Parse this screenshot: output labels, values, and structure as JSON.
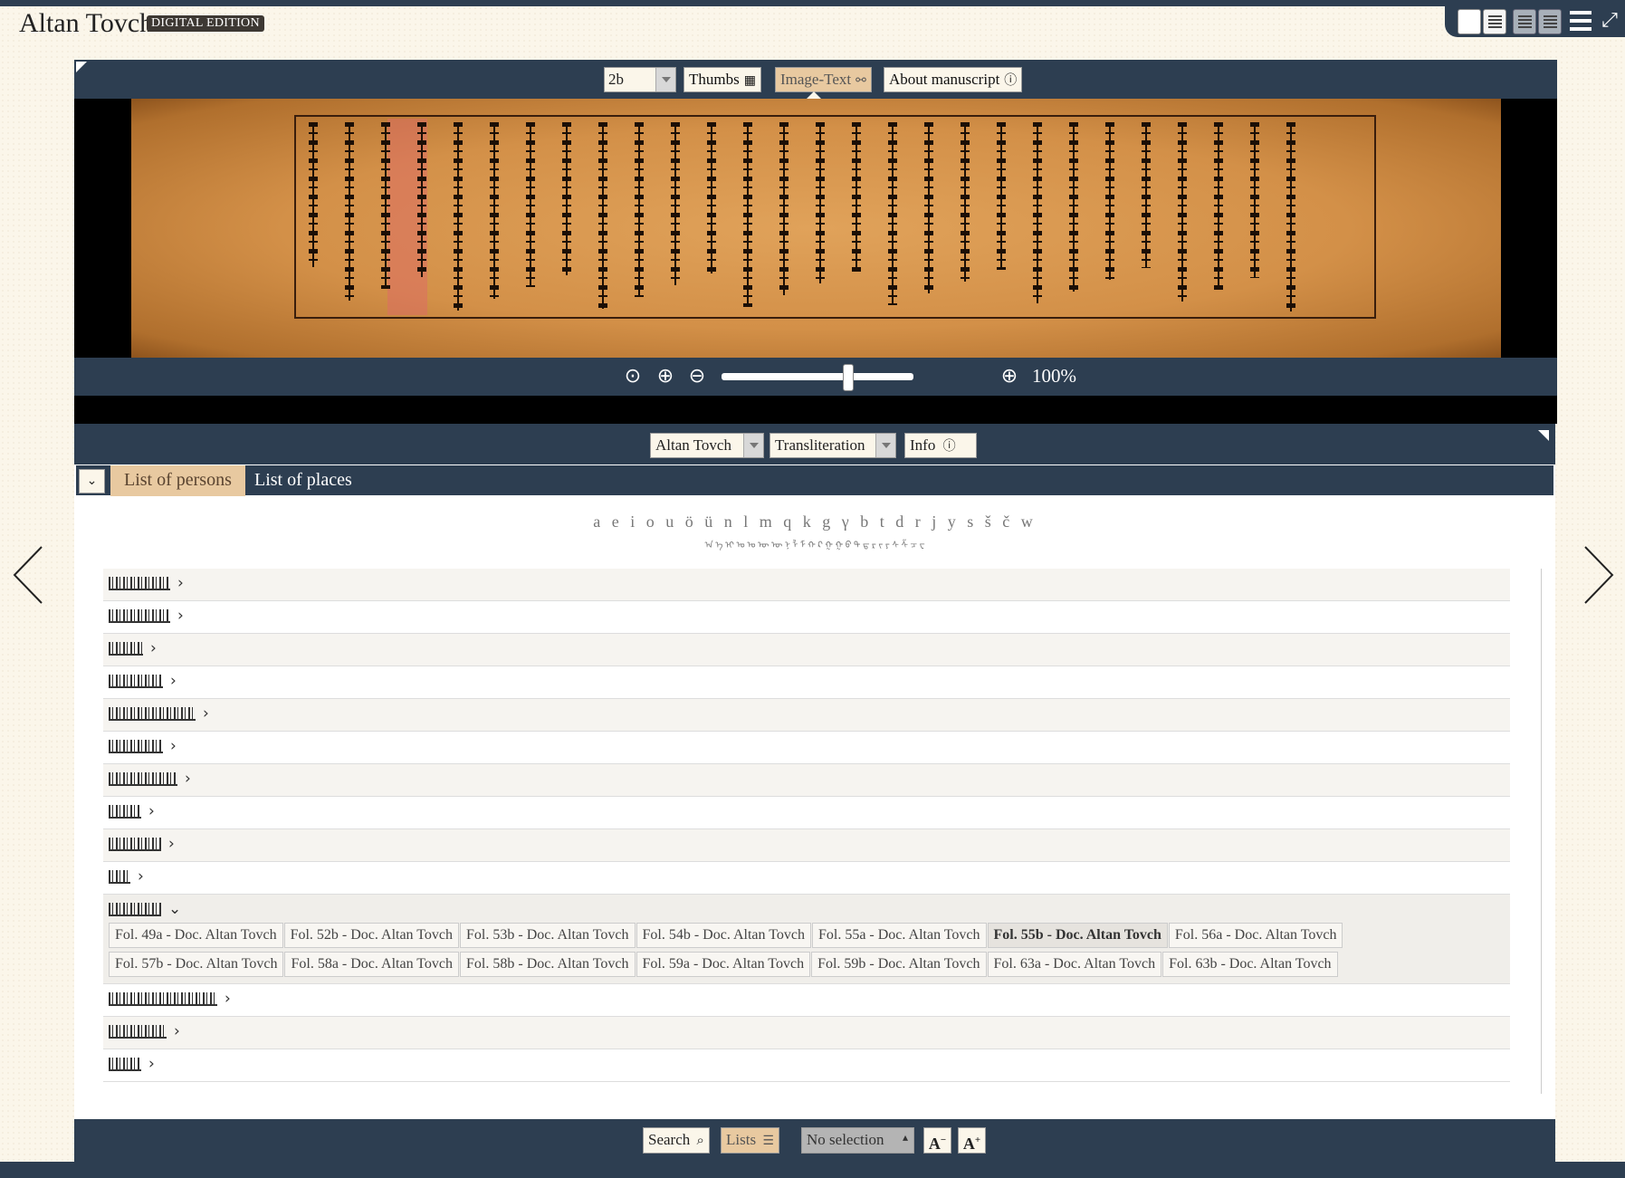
{
  "app": {
    "title": "Altan Tovch",
    "badge": "DIGITAL EDITION"
  },
  "image_toolbar": {
    "page_value": "2b",
    "thumbs_label": "Thumbs",
    "image_text_label": "Image-Text",
    "about_label": "About manuscript",
    "thumbs_icon": "grid-icon",
    "image_text_icon": "link-icon",
    "about_icon": "info-icon"
  },
  "zoom": {
    "level": "100%",
    "slider_fraction": 0.66
  },
  "text_toolbar": {
    "document_value": "Altan Tovch",
    "mode_value": "Transliteration",
    "info_label": "Info"
  },
  "tabs": [
    {
      "label": "List of persons",
      "active": true
    },
    {
      "label": "List of places",
      "active": false
    }
  ],
  "alphabet_latin": "a e i o u ö ü n l m q k g γ b t d r j y s š č w",
  "alphabet_script": "ᠠ ᠡ ᠢ ᠣ ᠤ ᠥ ᠦ ᠨ ᠯ ᠮ ᠬ ᠺ ᠭ ᠭ ᠪ ᠲ ᠳ ᠷ ᠵ ᠶ ᠰ ᠱ ᠴ ᠸ",
  "persons": [
    {
      "expanded": false
    },
    {
      "expanded": false
    },
    {
      "expanded": false
    },
    {
      "expanded": false
    },
    {
      "expanded": false
    },
    {
      "expanded": false
    },
    {
      "expanded": false
    },
    {
      "expanded": false
    },
    {
      "expanded": false
    },
    {
      "expanded": false
    },
    {
      "expanded": true,
      "folios": [
        {
          "label": "Fol. 49a - Doc. Altan Tovch",
          "selected": false
        },
        {
          "label": "Fol. 52b - Doc. Altan Tovch",
          "selected": false
        },
        {
          "label": "Fol. 53b - Doc. Altan Tovch",
          "selected": false
        },
        {
          "label": "Fol. 54b - Doc. Altan Tovch",
          "selected": false
        },
        {
          "label": "Fol. 55a - Doc. Altan Tovch",
          "selected": false
        },
        {
          "label": "Fol. 55b - Doc. Altan Tovch",
          "selected": true
        },
        {
          "label": "Fol. 56a - Doc. Altan Tovch",
          "selected": false
        },
        {
          "label": "Fol. 57b - Doc. Altan Tovch",
          "selected": false
        },
        {
          "label": "Fol. 58a - Doc. Altan Tovch",
          "selected": false
        },
        {
          "label": "Fol. 58b - Doc. Altan Tovch",
          "selected": false
        },
        {
          "label": "Fol. 59a - Doc. Altan Tovch",
          "selected": false
        },
        {
          "label": "Fol. 59b - Doc. Altan Tovch",
          "selected": false
        },
        {
          "label": "Fol. 63a - Doc. Altan Tovch",
          "selected": false
        },
        {
          "label": "Fol. 63b - Doc. Altan Tovch",
          "selected": false
        }
      ]
    },
    {
      "expanded": false
    },
    {
      "expanded": false
    },
    {
      "expanded": false
    }
  ],
  "bottom_toolbar": {
    "search_label": "Search",
    "lists_label": "Lists",
    "selection_value": "No selection",
    "font_decrease": "A",
    "font_increase": "A"
  },
  "colors": {
    "toolbar": "#2d3e51",
    "background": "#fbf6ea",
    "active_tab": "#e8c9a0"
  }
}
